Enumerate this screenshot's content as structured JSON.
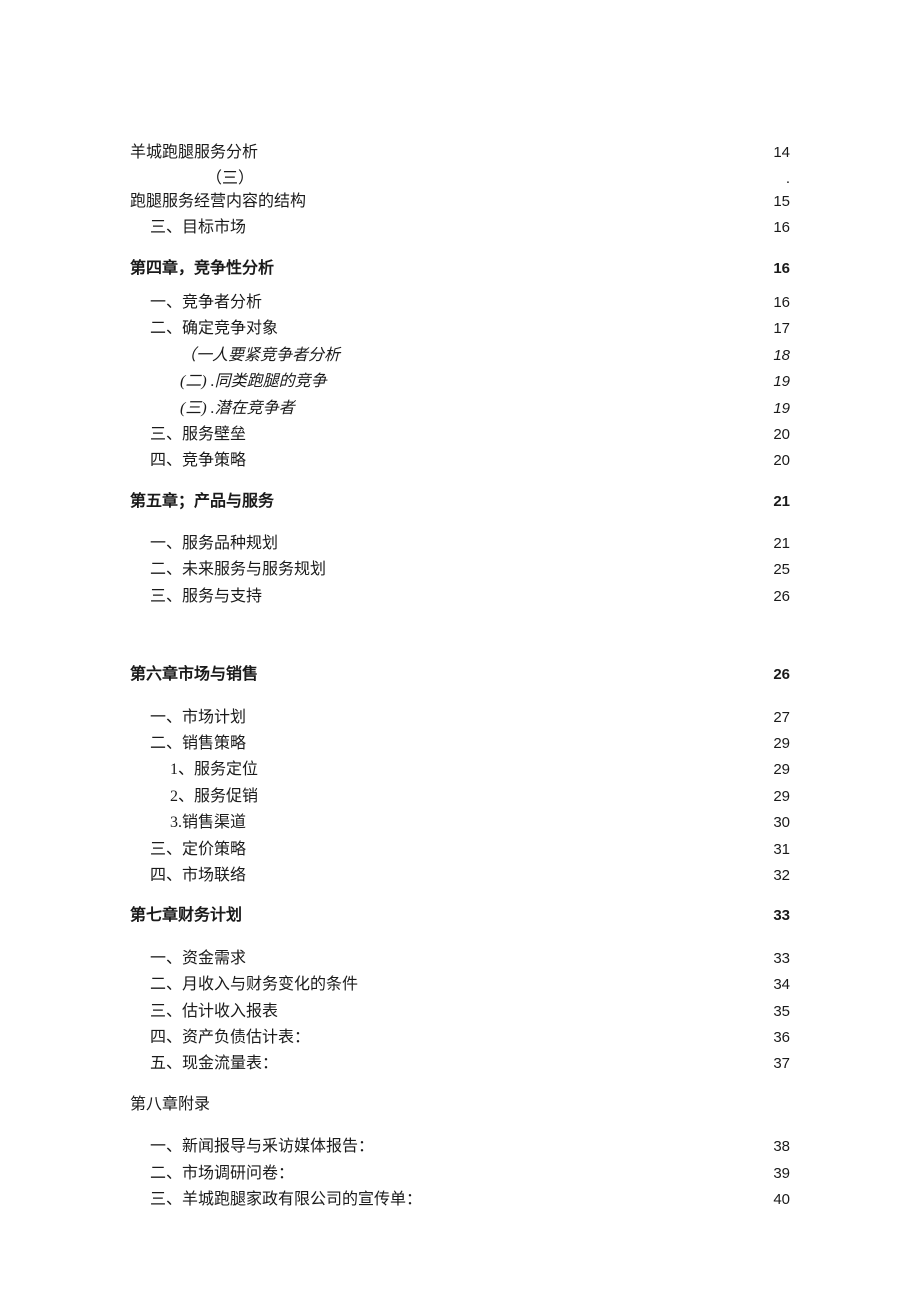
{
  "toc": {
    "pre": [
      {
        "label": "羊城跑腿服务分析",
        "page": "14",
        "indent": 0,
        "bold": false
      },
      {
        "label": "（三）",
        "page": "",
        "indent": 0,
        "bold": false,
        "centered": true,
        "dot": true
      },
      {
        "label": "跑腿服务经营内容的结构",
        "page": "15",
        "indent": 0,
        "bold": false
      },
      {
        "label": "三、目标市场",
        "page": "16",
        "indent": 1,
        "bold": false
      }
    ],
    "ch4": {
      "title": {
        "label": "第四章，竞争性分析",
        "page": "16"
      },
      "items": [
        {
          "label": "一、竞争者分析",
          "page": "16",
          "indent": 1
        },
        {
          "label": "二、确定竞争对象",
          "page": "17",
          "indent": 1
        },
        {
          "label": "（一人要紧竞争者分析",
          "page": "18",
          "indent": 3,
          "italic": true
        },
        {
          "label": "(二) .同类跑腿的竞争",
          "page": "19",
          "indent": 3,
          "italic": true
        },
        {
          "label": "(三) .潜在竞争者",
          "page": "19",
          "indent": 3,
          "italic": true
        },
        {
          "label": "三、服务壁垒",
          "page": "20",
          "indent": 1
        },
        {
          "label": "四、竞争策略",
          "page": "20",
          "indent": 1
        }
      ]
    },
    "ch5": {
      "title": {
        "label": "第五章；产品与服务",
        "page": "21"
      },
      "items": [
        {
          "label": "一、服务品种规划",
          "page": "21",
          "indent": 1
        },
        {
          "label": "二、未来服务与服务规划",
          "page": "25",
          "indent": 1
        },
        {
          "label": "三、服务与支持",
          "page": "26",
          "indent": 1
        }
      ]
    },
    "ch6": {
      "title": {
        "label": "第六章市场与销售",
        "page": "26"
      },
      "items": [
        {
          "label": "一、市场计划",
          "page": "27",
          "indent": 1
        },
        {
          "label": "二、销售策略",
          "page": "29",
          "indent": 1
        },
        {
          "label": "1、服务定位",
          "page": "29",
          "indent": 2
        },
        {
          "label": "2、服务促销",
          "page": "29",
          "indent": 2
        },
        {
          "label": "3.销售渠道",
          "page": "30",
          "indent": 2
        },
        {
          "label": "三、定价策略",
          "page": "31",
          "indent": 1
        },
        {
          "label": "四、市场联络",
          "page": "32",
          "indent": 1
        }
      ]
    },
    "ch7": {
      "title": {
        "label": "第七章财务计划",
        "page": "33"
      },
      "items": [
        {
          "label": "一、资金需求",
          "page": "33",
          "indent": 1
        },
        {
          "label": "二、月收入与财务变化的条件",
          "page": "34",
          "indent": 1
        },
        {
          "label": "三、估计收入报表",
          "page": "35",
          "indent": 1
        },
        {
          "label": "四、资产负债估计表：",
          "page": "36",
          "indent": 1
        },
        {
          "label": "五、现金流量表：",
          "page": "37",
          "indent": 1
        }
      ]
    },
    "ch8": {
      "title": {
        "label": "第八章附录",
        "page": ""
      },
      "items": [
        {
          "label": "一、新闻报导与釆访媒体报告：",
          "page": "38",
          "indent": 1
        },
        {
          "label": "二、市场调研问卷：",
          "page": "39",
          "indent": 1
        },
        {
          "label": "三、羊城跑腿家政有限公司的宣传单：",
          "page": "40",
          "indent": 1
        }
      ]
    }
  }
}
